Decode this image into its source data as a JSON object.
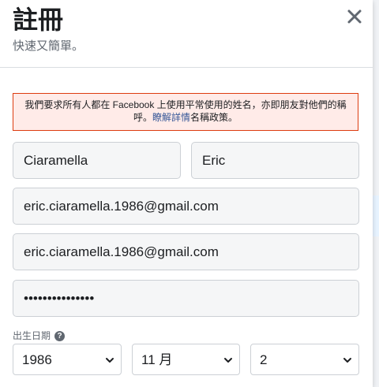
{
  "dialog": {
    "title": "註冊",
    "subtitle": "快速又簡單。",
    "close_icon": "close-icon"
  },
  "notice": {
    "text_before": "我們要求所有人都在 Facebook 上使用平常使用的姓名，亦即朋友對他們的稱呼。",
    "link_text": "瞭解詳情",
    "text_after": "名稱政策。"
  },
  "form": {
    "first_name": "Ciaramella",
    "last_name": "Eric",
    "email": "eric.ciaramella.1986@gmail.com",
    "email_confirm": "eric.ciaramella.1986@gmail.com",
    "password": "•••••••••••••••",
    "birthday_label": "出生日期",
    "birth_year": "1986",
    "birth_month": "11 月",
    "birth_day": "2"
  },
  "colors": {
    "notice_border": "#dd3c10",
    "notice_bg": "#ffebe8",
    "link": "#385898"
  }
}
